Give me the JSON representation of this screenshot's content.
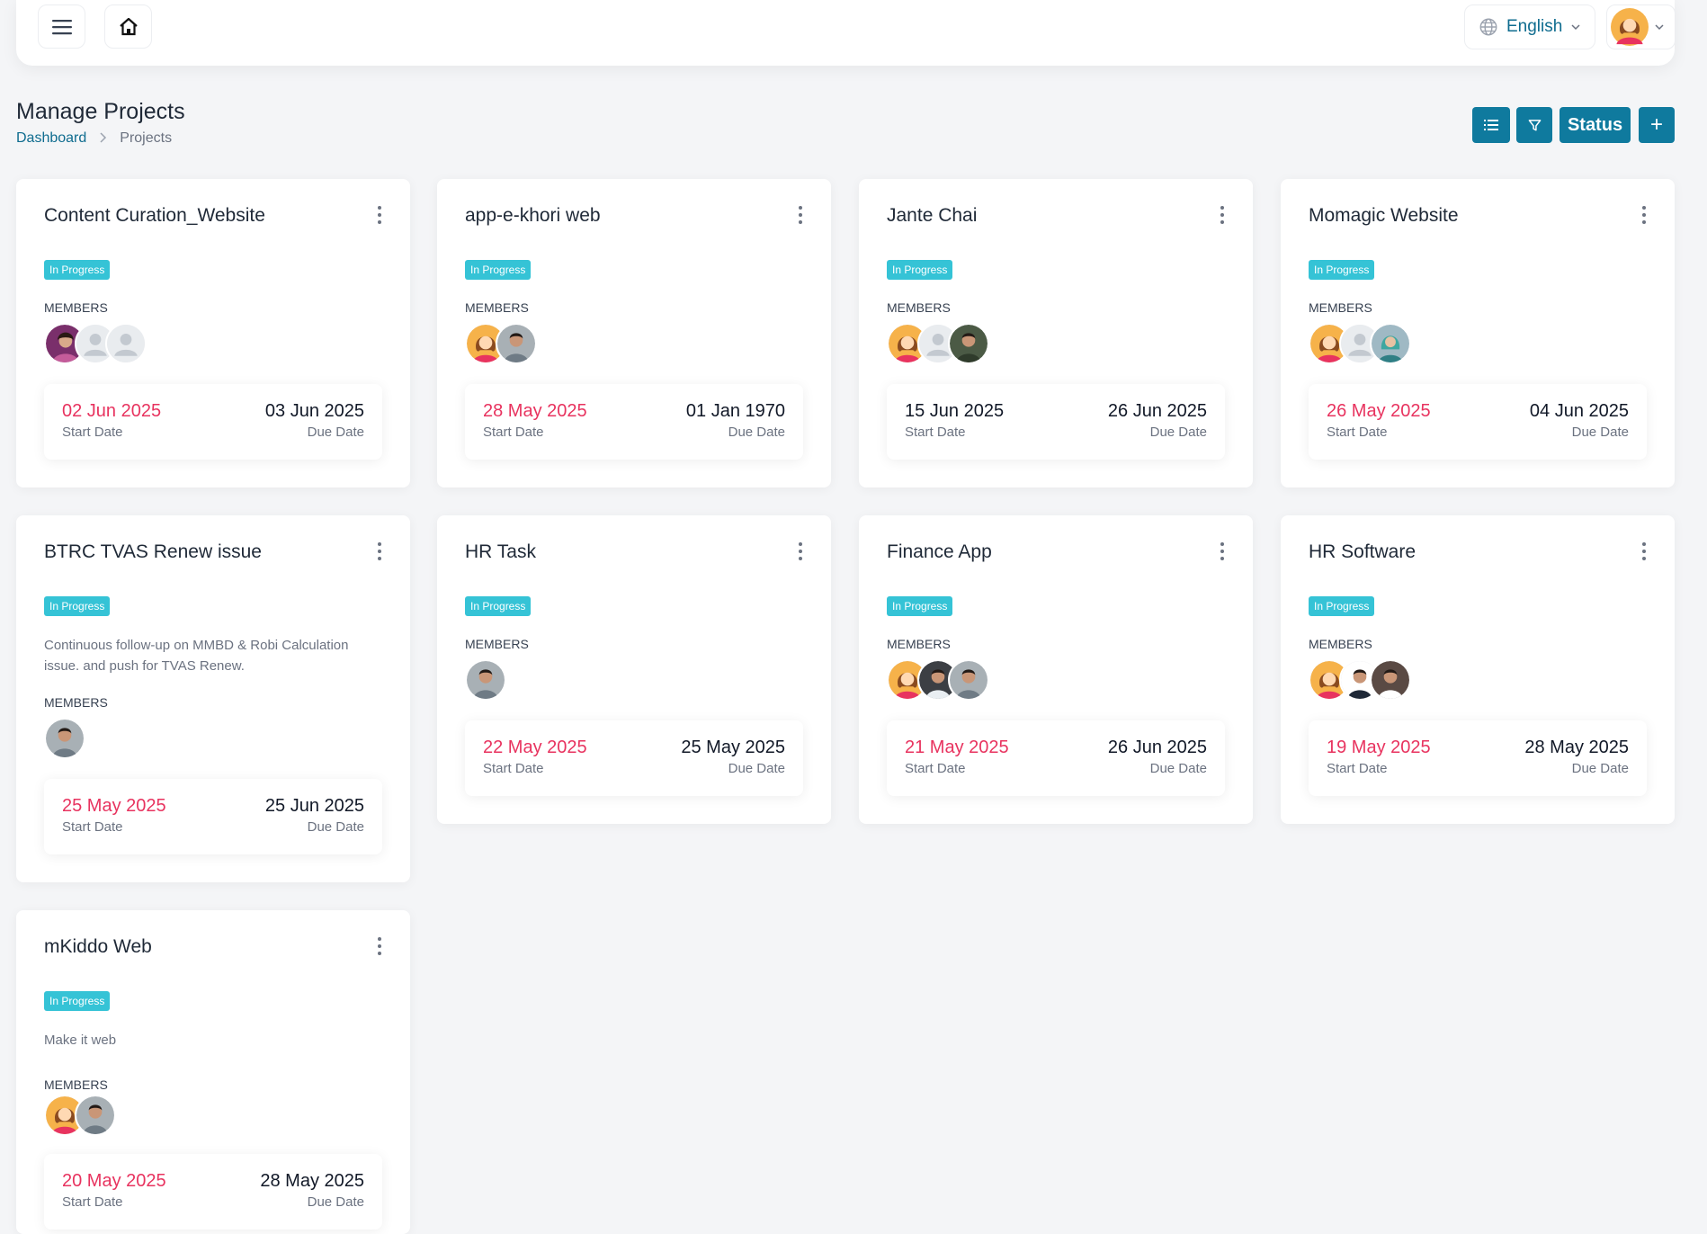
{
  "header": {
    "language": "English"
  },
  "page": {
    "title": "Manage Projects",
    "breadcrumb": {
      "home": "Dashboard",
      "current": "Projects"
    },
    "status_button": "Status",
    "add_button": "+"
  },
  "labels": {
    "members": "MEMBERS",
    "start_date": "Start Date",
    "due_date": "Due Date"
  },
  "projects": [
    {
      "title": "Content Curation_Website",
      "status": "In Progress",
      "description": "",
      "start": "02 Jun 2025",
      "due": "03 Jun 2025"
    },
    {
      "title": "app-e-khori web",
      "status": "In Progress",
      "description": "",
      "start": "28 May 2025",
      "due": "01 Jan 1970"
    },
    {
      "title": "Jante Chai",
      "status": "In Progress",
      "description": "",
      "start": "15 Jun 2025",
      "due": "26 Jun 2025"
    },
    {
      "title": "Momagic Website",
      "status": "In Progress",
      "description": "",
      "start": "26 May 2025",
      "due": "04 Jun 2025"
    },
    {
      "title": "BTRC TVAS Renew issue",
      "status": "In Progress",
      "description": "Continuous follow-up on MMBD & Robi Calculation issue. and push for TVAS Renew.",
      "start": "25 May 2025",
      "due": "25 Jun 2025"
    },
    {
      "title": "HR Task",
      "status": "In Progress",
      "description": "",
      "start": "22 May 2025",
      "due": "25 May 2025"
    },
    {
      "title": "Finance App",
      "status": "In Progress",
      "description": "",
      "start": "21 May 2025",
      "due": "26 Jun 2025"
    },
    {
      "title": "HR Software",
      "status": "In Progress",
      "description": "",
      "start": "19 May 2025",
      "due": "28 May 2025"
    },
    {
      "title": "mKiddo Web",
      "status": "In Progress",
      "description": "Make it web",
      "start": "20 May 2025",
      "due": "28 May 2025"
    }
  ],
  "colors": {
    "accent": "#0f7a9e",
    "badge": "#35c3d6",
    "start_date": "#e8335f"
  }
}
